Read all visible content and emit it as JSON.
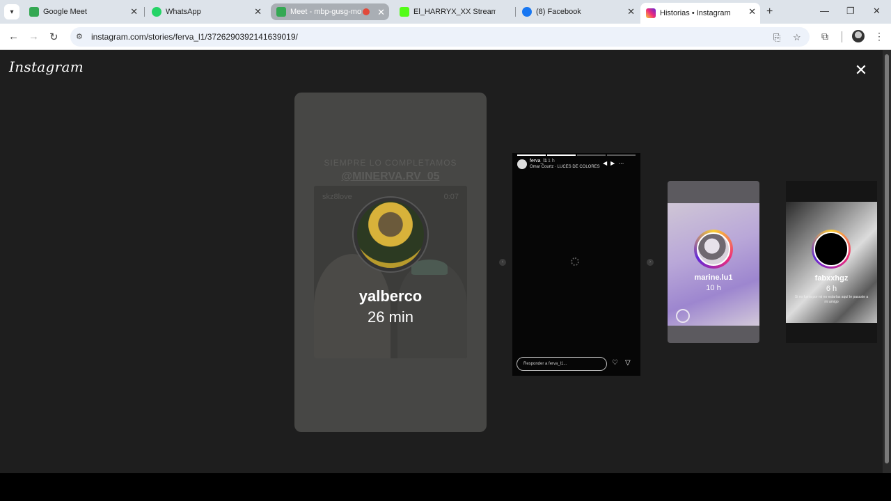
{
  "browser": {
    "tabs": [
      {
        "title": "Google Meet",
        "favicon_color": "#34a853"
      },
      {
        "title": "WhatsApp",
        "favicon_color": "#25d366"
      },
      {
        "title": "Meet - mbp-gusg-mo",
        "favicon_color": "#34a853"
      },
      {
        "title": "El_HARRYX_XX Stream - W",
        "favicon_color": "#53fc18"
      },
      {
        "title": "(8) Facebook",
        "favicon_color": "#1877f2"
      },
      {
        "title": "Historias • Instagram",
        "favicon_color": "#e1306c"
      }
    ],
    "new_tab": "+",
    "url": "instagram.com/stories/ferva_l1/3726290392141639019/"
  },
  "instagram": {
    "logo": "Instagram",
    "close": "✕",
    "left_story": {
      "overlay_line1": "SIEMPRE LO COMPLETAMOS",
      "overlay_line2": "@MINERVA.RV_05",
      "sub_user": "skz8love",
      "sub_time": "0:07",
      "username": "yalberco",
      "time": "26 min"
    },
    "active_story": {
      "username": "ferva_l1",
      "time": "1 h",
      "song": "Omar Courtz · LUCES DE COLORES",
      "reply_placeholder": "Responder a ferva_l1...",
      "progress_segments": [
        1,
        1,
        0,
        0
      ]
    },
    "right_story_1": {
      "username": "marine.lu1",
      "time": "10 h"
    },
    "right_story_2": {
      "username": "fabxxhgz",
      "time": "6 h",
      "caption": "Si no fuera por mi no estarías aquí te pasaste a mi amigo"
    }
  }
}
